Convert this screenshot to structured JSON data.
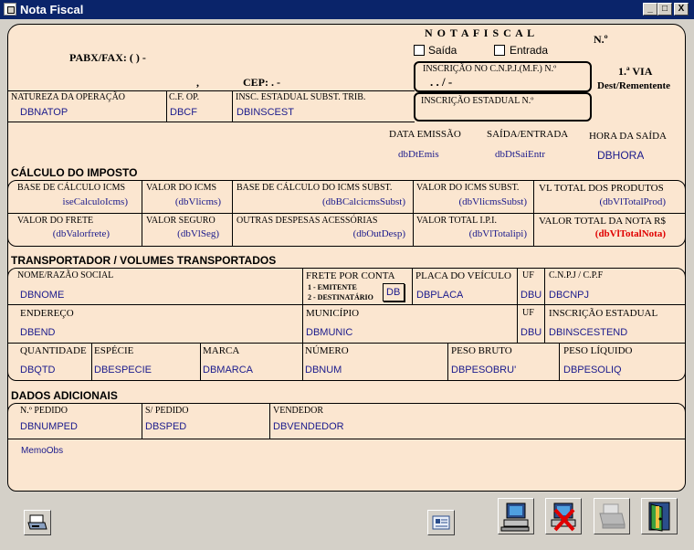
{
  "window": {
    "title": "Nota Fiscal",
    "min": "_",
    "max": "□",
    "close": "X"
  },
  "header": {
    "nota_fiscal": "N O T A  F I S C A L",
    "saida": "Saída",
    "entrada": "Entrada",
    "numero": "N.º",
    "pabx": "PABX/FAX:  (  )   -",
    "comma": ",",
    "cep": "CEP:   .   -",
    "cnpj_label": "INSCRIÇÃO NO C.N.P.J.(M.F.) N.º",
    "cnpj_value": ".  .   /   -",
    "via": "1.ª VIA",
    "via_sub": "Dest/Rementente",
    "ie_label": "INSCRIÇÃO ESTADUAL N.º"
  },
  "natureza": {
    "lbl_natop": "NATUREZA DA OPERAÇÃO",
    "natop": "DBNATOP",
    "lbl_cfop": "C.F. OP.",
    "cfop": "DBCF",
    "lbl_inscest": "INSC. ESTADUAL SUBST. TRIB.",
    "inscest": "DBINSCEST"
  },
  "datas": {
    "lbl_emissao": "DATA EMISSÃO",
    "emissao": "dbDtEmis",
    "lbl_saient": "SAÍDA/ENTRADA",
    "saient": "dbDtSaiEntr",
    "lbl_hora": "HORA DA SAÍDA",
    "hora": "DBHORA"
  },
  "imposto": {
    "title": "CÁLCULO DO IMPOSTO",
    "lbl_base": "BASE DE CÁLCULO ICMS",
    "base": "iseCalculoIcms)",
    "lbl_vicms": "VALOR DO ICMS",
    "vicms": "(dbVlicms)",
    "lbl_basesubst": "BASE DE CÁLCULO DO ICMS SUBST.",
    "basesubst": "(dbBCalcicmsSubst)",
    "lbl_vicmssubst": "VALOR DO ICMS SUBST.",
    "vicmssubst": "(dbVlicmsSubst)",
    "lbl_vtotprod": "VL TOTAL DOS PRODUTOS",
    "vtotprod": "(dbVlTotalProd)",
    "lbl_frete": "VALOR DO FRETE",
    "frete": "(dbValorfrete)",
    "lbl_seguro": "VALOR SEGURO",
    "seguro": "(dbVlSeg)",
    "lbl_outras": "OUTRAS DESPESAS ACESSÓRIAS",
    "outras": "(dbOutDesp)",
    "lbl_ipi": "VALOR TOTAL I.P.I.",
    "ipi": "(dbVlTotalipi)",
    "lbl_totnota": "VALOR TOTAL DA NOTA R$",
    "totnota": "(dbVlTotalNota)"
  },
  "transp": {
    "title": "TRANSPORTADOR / VOLUMES TRANSPORTADOS",
    "lbl_nome": "NOME/RAZÃO SOCIAL",
    "nome": "DBNOME",
    "lbl_frete": "FRETE POR CONTA",
    "frete_op1": "1 - EMITENTE",
    "frete_op2": "2 - DESTINATÁRIO",
    "frete_val": "DB",
    "lbl_placa": "PLACA DO VEÍCULO",
    "placa": "DBPLACA",
    "lbl_uf": "UF",
    "uf": "DBU",
    "lbl_cnpj": "C.N.P.J / C.P.F",
    "cnpj": "DBCNPJ",
    "lbl_end": "ENDEREÇO",
    "end": "DBEND",
    "lbl_munic": "MUNICÍPIO",
    "munic": "DBMUNIC",
    "lbl_uf2": "UF",
    "uf2": "DBU",
    "lbl_ie": "INSCRIÇÃO ESTADUAL",
    "ie": "DBINSCESTEND",
    "lbl_qtd": "QUANTIDADE",
    "qtd": "DBQTD",
    "lbl_esp": "ESPÉCIE",
    "esp": "DBESPECIE",
    "lbl_marca": "MARCA",
    "marca": "DBMARCA",
    "lbl_num": "NÚMERO",
    "num": "DBNUM",
    "lbl_pbruto": "PESO BRUTO",
    "pbruto": "DBPESOBRU'",
    "lbl_pliq": "PESO LÍQUIDO",
    "pliq": "DBPESOLIQ"
  },
  "adicionais": {
    "title": "DADOS ADICIONAIS",
    "lbl_numped": "N.º PEDIDO",
    "numped": "DBNUMPED",
    "lbl_sped": "S/ PEDIDO",
    "sped": "DBSPED",
    "lbl_vend": "VENDEDOR",
    "vend": "DBVENDEDOR",
    "memo": "MemoObs"
  },
  "icons": [
    "printer-icon",
    "card-icon",
    "computer-icon",
    "cancel-icon",
    "printer-disabled-icon",
    "exit-door-icon"
  ],
  "colors": {
    "form_bg": "#fbe6d0",
    "value_blue": "#1a1a8c",
    "total_red": "#e00000",
    "titlebar": "#0a246a"
  }
}
